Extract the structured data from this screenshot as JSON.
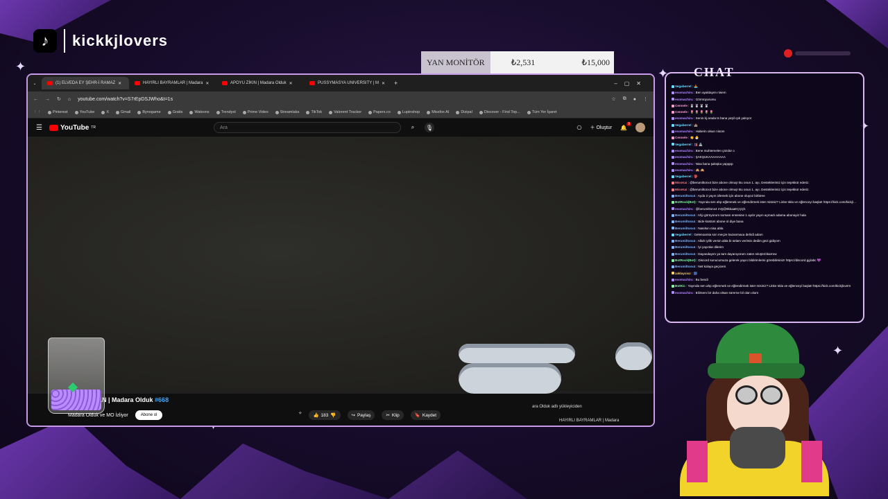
{
  "overlay": {
    "brand_name": "kickkjlovers",
    "goal": {
      "label": "YAN MONİTÖR",
      "current": "₺2,531",
      "target": "₺15,000"
    },
    "chat_title": "CHAT"
  },
  "browser": {
    "tabs": [
      {
        "label": "(1) ELVEDA EY ŞEHR-İ RAMAZ",
        "active": true
      },
      {
        "label": "HAYIRLI BAYRAMLAR | Madara",
        "active": false
      },
      {
        "label": "APOYU ZİKIN | Madara Olduk",
        "active": false
      },
      {
        "label": "PUSSYMASYA UNIVERSITY | M",
        "active": false
      }
    ],
    "url": "youtube.com/watch?v=S7rEpDSJWho&t=1s",
    "bookmarks": [
      "Pinterest",
      "YouTube",
      "X",
      "Gmail",
      "Bynogame",
      "Gratis",
      "Watsons",
      "Trendyol",
      "Prime Video",
      "Streamlabs",
      "TikTok",
      "Valorent Tracker",
      "Papers.co",
      "Lupinshop",
      "Missfox AI",
      "Dizipal",
      "Discover - Find Top...",
      "Tüm Yer İşaret"
    ]
  },
  "youtube": {
    "logo_text": "YouTube",
    "logo_country": "TR",
    "search_placeholder": "Ara",
    "create_label": "Oluştur",
    "notif_count": "9",
    "video_title": "-İ RAMAZAN | Madara Olduk",
    "video_number": "#668",
    "channel": "Madara Olduk ve MO İzliyor",
    "subscribe": "Abone ol",
    "likes": "183",
    "share": "Paylaş",
    "clip": "Klip",
    "save": "Kaydet",
    "up_next_1": "ara Olduk adlı yükleyiciden",
    "up_next_2": "HAYIRLI BAYRAMLAR | Madara"
  },
  "chat": [
    {
      "user": "Vegaberrel",
      "text": " : 🚣",
      "color": "#66e0ff"
    },
    {
      "user": "esomachiru",
      "text": " : Ben ayaktayım nisem",
      "color": "#b48cff"
    },
    {
      "user": "esomachiru",
      "text": " : Görmüyorumu",
      "color": "#b48cff"
    },
    {
      "user": "Cennele",
      "text": " : 🐰 🐰 🐰 🐰",
      "color": "#ff9bd2"
    },
    {
      "user": "Cennele",
      "text": " : 🌷 🌷 🌷 🌷 🌷",
      "color": "#ff9bd2"
    },
    {
      "user": "esomachiru",
      "text": " : Senin kj arada ts bana yeşil ışık yakıyor",
      "color": "#b48cff"
    },
    {
      "user": "Vegaberrel",
      "text": " : 🏰",
      "color": "#66e0ff"
    },
    {
      "user": "esomachiru",
      "text": " : Haberin olsun nisom",
      "color": "#b48cff"
    },
    {
      "user": "Cennele",
      "text": " : 👏 🐣",
      "color": "#ff9bd2"
    },
    {
      "user": "Vegaberrel",
      "text": " : 🎎 🏯",
      "color": "#66e0ff"
    },
    {
      "user": "esomachiru",
      "text": " : Bene muhtemelen çözdür o",
      "color": "#b48cff"
    },
    {
      "user": "esomachiru",
      "text": " : ŞAKŞUKAAAAAAAA",
      "color": "#b48cff"
    },
    {
      "user": "esomachiru",
      "text": " : Nisa bana şakışka yapppp",
      "color": "#b48cff"
    },
    {
      "user": "esomachiru",
      "text": " : 🙈 🙉",
      "color": "#b48cff"
    },
    {
      "user": "Vegaberrel",
      "text": " : 👺",
      "color": "#66e0ff"
    },
    {
      "user": "MissKai",
      "text": " : @berumiltonx4 bize abone olmuş! Bu onun 1. ayı. Desteklerimiz için teşekkür ederiz.",
      "color": "#ff7a7a"
    },
    {
      "user": "MissKai",
      "text": " : @berumiltonx4 bize abone olmuş! Bu onun 1. ayı. Desteklerimiz için teşekkür ederiz.",
      "color": "#ff7a7a"
    },
    {
      "user": "Berumiltonx4",
      "text": " : Ayda 2 yayın izlemek için abone oluyoz birbiree",
      "color": "#7ab8ff"
    },
    {
      "user": "BotRock(Bot)",
      "text": " : Yayında sen ahp eğlenmek ve eğlendirmek ister misiniz? Linke tıkla ve eğlenceyi başlat! https://kick.com/kickjlovers",
      "color": "#7cff9c"
    },
    {
      "user": "esomachiru",
      "text": " : @berumiltonx4 mQ@9kkaaEÇÇÇk",
      "color": "#b48cff"
    },
    {
      "user": "Berumiltonx4",
      "text": " : Ahjı görüyorum sorsam ensesine 1 aydır yayın açmadı adama abonayiz hala",
      "color": "#7ab8ff"
    },
    {
      "user": "Berumiltonx4",
      "text": " : Bide küstüm abone ol diye bana",
      "color": "#7ab8ff"
    },
    {
      "user": "Berumiltonx4",
      "text": " : Nasılsın nisa abla",
      "color": "#7ab8ff"
    },
    {
      "user": "Vegaberrel",
      "text": " : Gelenoamia son meçze kazanmaca delirdi adam",
      "color": "#66e0ff"
    },
    {
      "user": "Berumiltonx4",
      "text": " : Allah iyilik versin abla bi selam verirsin dedim gezi gidiyom",
      "color": "#7ab8ff"
    },
    {
      "user": "Berumiltonx4",
      "text": " : İyi yayınlar dilerim",
      "color": "#7ab8ff"
    },
    {
      "user": "Berumiltonx4",
      "text": " : Dayandayım ya tam dayanıyorum zaten sıkıştırılıkarrow",
      "color": "#7ab8ff"
    },
    {
      "user": "BotRock(Bot)",
      "text": " : Discord sunucumuza gelerek yayın bildirimlerini görebilirsiniz! https://discord.gg/abc 💜",
      "color": "#7cff9c"
    },
    {
      "user": "Berumiltonx4",
      "text": " : Net kolaya geçicem",
      "color": "#7ab8ff"
    },
    {
      "user": "zaklaycioz",
      "text": " : 🎆",
      "color": "#ffd36b"
    },
    {
      "user": "esomachiru",
      "text": " : Bu bendi",
      "color": "#b48cff"
    },
    {
      "user": "BotKic",
      "text": " : Yayında sen ahp eğlenmek ve eğlendirmek ister misiniz? Linke tıkla ve eğlenceyi başlat! https://kick.com/kickjlovers",
      "color": "#7cff9c"
    },
    {
      "user": "esomachiru",
      "text": " : Bilirsem bir daha olsan sürerne bil olan olurs",
      "color": "#b48cff"
    }
  ]
}
